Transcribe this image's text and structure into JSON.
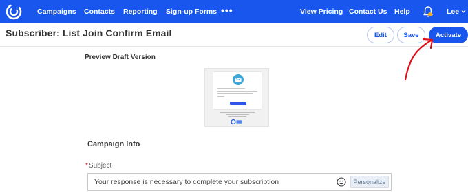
{
  "nav": {
    "left_items": [
      {
        "label": "Campaigns"
      },
      {
        "label": "Contacts"
      },
      {
        "label": "Reporting"
      },
      {
        "label": "Sign-up Forms"
      }
    ],
    "more_label": "•••",
    "right_items": [
      {
        "label": "View Pricing"
      },
      {
        "label": "Contact Us"
      },
      {
        "label": "Help"
      }
    ],
    "user_label": "Lee",
    "logo_icon": "constant-contact-logo-icon",
    "bell_icon": "bell-icon",
    "notification_dot_color": "#f5a623",
    "bar_color": "#1856ed"
  },
  "header": {
    "title": "Subscriber: List Join Confirm Email",
    "edit_label": "Edit",
    "save_label": "Save",
    "activate_label": "Activate"
  },
  "annotation": {
    "arrow_color": "#e0101a"
  },
  "preview": {
    "label": "Preview Draft Version"
  },
  "campaign_info": {
    "section_title": "Campaign Info",
    "subject_required_mark": "*",
    "subject_label": "Subject",
    "subject_value": "Your response is necessary to complete your subscription",
    "emoji_icon": "smiley-icon",
    "personalize_label": "Personalize"
  }
}
